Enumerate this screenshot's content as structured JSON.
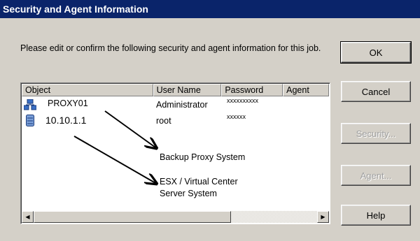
{
  "window": {
    "title": "Security and Agent Information"
  },
  "prompt": "Please edit or confirm the following security and agent information for this job.",
  "buttons": {
    "ok": "OK",
    "cancel": "Cancel",
    "security": "Security...",
    "agent": "Agent...",
    "help": "Help"
  },
  "table": {
    "columns": [
      "Object",
      "User Name",
      "Password",
      "Agent"
    ],
    "rows": [
      {
        "object": "PROXY01",
        "user": "Administrator",
        "password": "xxxxxxxxxx",
        "agent": "",
        "icon": "server-group-icon"
      },
      {
        "object": "10.10.1.1",
        "user": "root",
        "password": "xxxxxx",
        "agent": "",
        "icon": "database-server-icon"
      }
    ]
  },
  "annotations": {
    "proxy": "Backup Proxy System",
    "esx": "ESX / Virtual Center Server System"
  },
  "scrollbar": {
    "left_arrow": "◀",
    "right_arrow": "▶"
  },
  "colors": {
    "titlebar": "#0a246a",
    "face": "#d4d0c8"
  }
}
